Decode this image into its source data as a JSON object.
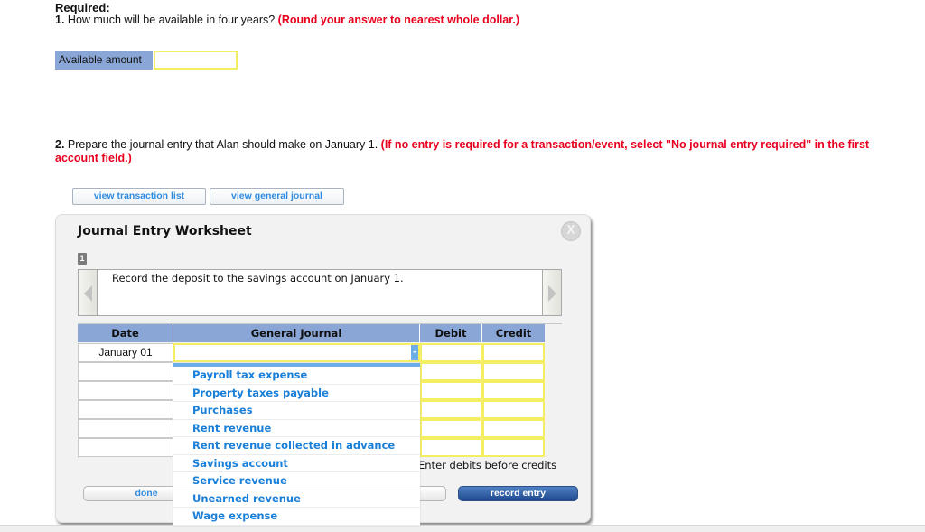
{
  "required": {
    "title": "Required:",
    "q1_number": "1.",
    "q1_text": " How much will be available in four years? ",
    "q1_note": "(Round your answer to nearest whole dollar.)",
    "available_label": "Available amount",
    "available_value": "",
    "q2_number": "2.",
    "q2_text": " Prepare the journal entry that Alan should make on January 1. ",
    "q2_note": "(If no entry is required for a transaction/event, select \"No journal entry required\" in the first account field.)"
  },
  "buttons": {
    "view_transaction_list": "view transaction list",
    "view_general_journal": "view general journal",
    "done": "done",
    "clear_entry": "",
    "record_entry": "record entry"
  },
  "worksheet": {
    "title": "Journal Entry Worksheet",
    "close_glyph": "X",
    "step_badge": "1",
    "description": "Record the deposit to the savings account on January 1.",
    "columns": {
      "date": "Date",
      "general_journal": "General Journal",
      "debit": "Debit",
      "credit": "Credit"
    },
    "rows": [
      {
        "date": "January 01",
        "account": "",
        "debit": "",
        "credit": ""
      },
      {
        "date": "",
        "account": "",
        "debit": "",
        "credit": ""
      },
      {
        "date": "",
        "account": "",
        "debit": "",
        "credit": ""
      },
      {
        "date": "",
        "account": "",
        "debit": "",
        "credit": ""
      },
      {
        "date": "",
        "account": "",
        "debit": "",
        "credit": ""
      },
      {
        "date": "",
        "account": "",
        "debit": "",
        "credit": ""
      }
    ],
    "hint": "Enter debits before credits",
    "dropdown_options": [
      "Payroll tax expense",
      "Property taxes payable",
      "Purchases",
      "Rent revenue",
      "Rent revenue collected in advance",
      "Savings account",
      "Service revenue",
      "Unearned revenue",
      "Wage expense"
    ]
  },
  "colors": {
    "accent_red": "#e8001e",
    "header_blue": "#8aa6d6",
    "link_blue": "#1a7fd8",
    "input_border_yellow": "#f4ef62",
    "primary_button": "#1f4a8f"
  }
}
